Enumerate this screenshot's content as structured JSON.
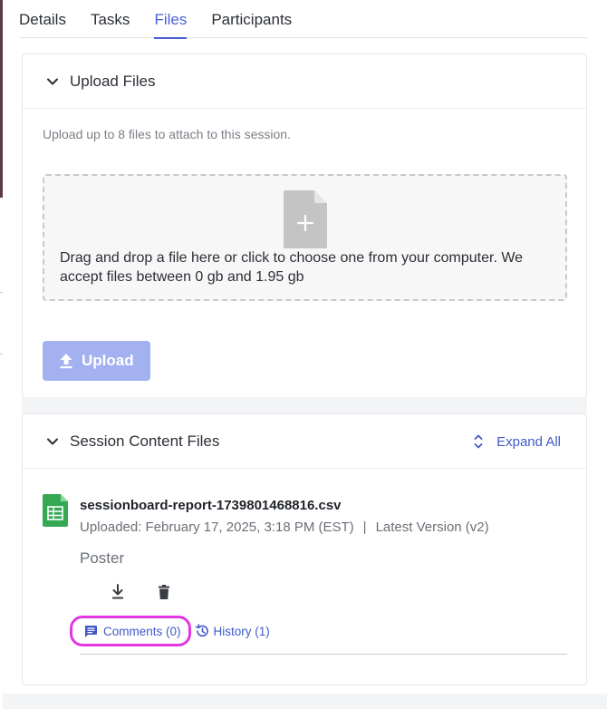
{
  "tabs": [
    {
      "label": "Details"
    },
    {
      "label": "Tasks"
    },
    {
      "label": "Files",
      "active": true
    },
    {
      "label": "Participants"
    }
  ],
  "upload": {
    "title": "Upload Files",
    "help_text": "Upload up to 8 files to attach to this session.",
    "dropzone_text": "Drag and drop a file here or click to choose one from your computer. We accept files between 0 gb and 1.95 gb",
    "button_label": "Upload"
  },
  "session_files": {
    "title": "Session Content Files",
    "expand_all_label": "Expand All",
    "file": {
      "name": "sessionboard-report-1739801468816.csv",
      "uploaded": "Uploaded: February 17, 2025, 3:18 PM (EST)",
      "separator": "|",
      "version": "Latest Version (v2)",
      "description": "Poster",
      "comments_label": "Comments (0)",
      "history_label": "History (1)"
    }
  },
  "colors": {
    "accent": "#4a5fd0",
    "link": "#4059c8",
    "upload_button": "#a4b1f1",
    "highlight": "#e236e2",
    "sheet_green": "#34a853"
  },
  "icons": [
    "chevron-down-icon",
    "file-plus-icon",
    "upload-icon",
    "expand-collapse-icon",
    "spreadsheet-icon",
    "download-icon",
    "trash-icon",
    "comment-icon",
    "history-icon"
  ]
}
